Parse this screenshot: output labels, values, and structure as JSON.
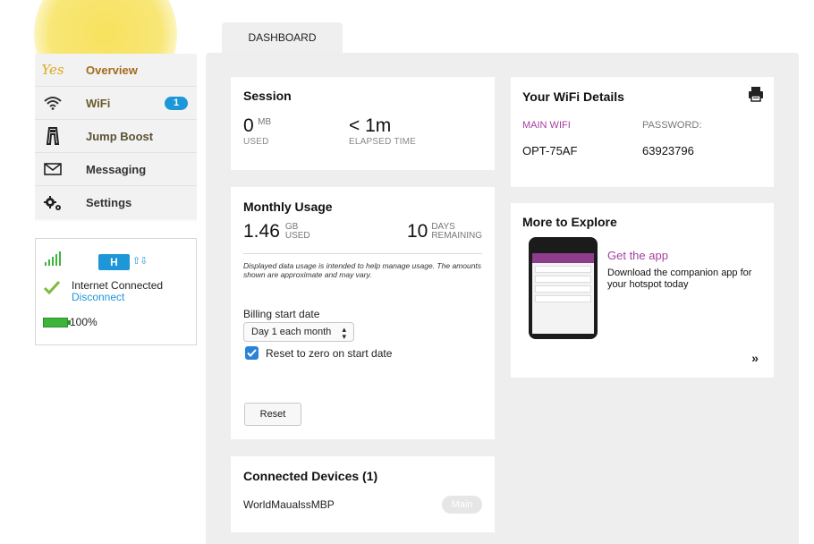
{
  "sidebar": {
    "items": [
      {
        "label": "Overview",
        "icon": "yes-logo-icon"
      },
      {
        "label": "WiFi",
        "icon": "wifi-icon",
        "badge": "1"
      },
      {
        "label": "Jump Boost",
        "icon": "jump-boost-icon"
      },
      {
        "label": "Messaging",
        "icon": "envelope-icon"
      },
      {
        "label": "Settings",
        "icon": "gears-icon"
      }
    ],
    "logo_text": "Yes"
  },
  "status": {
    "network_type": "H",
    "arrows": "⇧⇩",
    "connection": "Internet Connected",
    "disconnect": "Disconnect",
    "battery": "100%",
    "battery_level": 1.0
  },
  "tab": {
    "label": "DASHBOARD"
  },
  "session": {
    "title": "Session",
    "used_value": "0",
    "used_unit": "MB",
    "used_label": "USED",
    "elapsed_value": "< 1m",
    "elapsed_label": "ELAPSED TIME"
  },
  "usage": {
    "title": "Monthly Usage",
    "used_value": "1.46",
    "used_unit_top": "GB",
    "used_unit_bottom": "USED",
    "days_value": "10",
    "days_unit_top": "DAYS",
    "days_unit_bottom": "REMAINING",
    "disclaimer": "Displayed data usage is intended to help manage usage. The amounts shown are approximate and may vary.",
    "billing_label": "Billing start date",
    "billing_value": "Day 1 each month",
    "reset_zero_label": "Reset to zero on start date",
    "reset_button": "Reset"
  },
  "devices": {
    "title": "Connected Devices (1)",
    "list": [
      {
        "name": "WorldMaualssMBP",
        "tag": "Main"
      }
    ]
  },
  "wifi": {
    "title": "Your WiFi Details",
    "main_wifi_label": "MAIN WIFI",
    "password_label": "PASSWORD:",
    "ssid": "OPT-75AF",
    "password": "63923796"
  },
  "explore": {
    "title": "More to Explore",
    "get_app": "Get the app",
    "description": "Download the companion app for your hotspot today",
    "more": "»"
  },
  "colors": {
    "accent_blue": "#1e97d9",
    "purple": "#a73ea4",
    "highlight_yellow": "#f7e055",
    "battery_green": "#3db53a"
  }
}
